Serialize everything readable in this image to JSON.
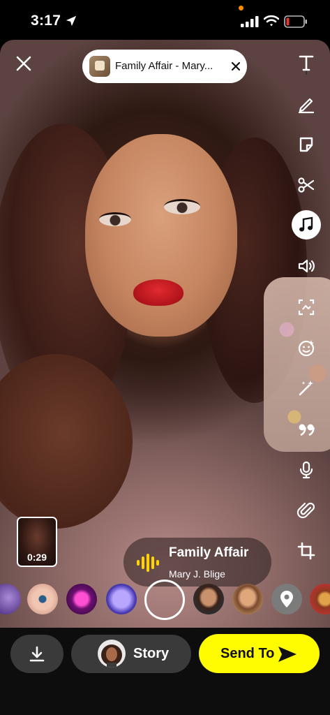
{
  "status_bar": {
    "time": "3:17",
    "location_icon": "location-arrow-icon",
    "signal_icon": "cellular-signal-icon",
    "wifi_icon": "wifi-icon",
    "battery_icon": "battery-low-icon",
    "battery_color": "#e53935",
    "indicator_color": "#ff8a00"
  },
  "sound_pill": {
    "title": "Family Affair - Mary...",
    "thumb_icon": "album-art-thumbnail",
    "close_icon": "close-icon"
  },
  "toolbar": {
    "tools": [
      {
        "name": "text-tool",
        "icon": "text-icon"
      },
      {
        "name": "draw-tool",
        "icon": "pencil-icon"
      },
      {
        "name": "sticker-tool",
        "icon": "sticker-icon"
      },
      {
        "name": "scissors-tool",
        "icon": "scissors-icon"
      },
      {
        "name": "music-tool",
        "icon": "music-note-icon",
        "active": true
      },
      {
        "name": "volume-tool",
        "icon": "speaker-icon"
      },
      {
        "name": "scan-tool",
        "icon": "scan-icon"
      },
      {
        "name": "lens-tool",
        "icon": "smiley-icon"
      },
      {
        "name": "magic-tool",
        "icon": "magic-wand-icon"
      },
      {
        "name": "quote-tool",
        "icon": "quote-icon"
      },
      {
        "name": "voice-tool",
        "icon": "microphone-icon"
      },
      {
        "name": "attach-tool",
        "icon": "paperclip-icon"
      },
      {
        "name": "crop-tool",
        "icon": "crop-icon"
      }
    ]
  },
  "clip": {
    "duration": "0:29"
  },
  "music_card": {
    "title": "Family Affair",
    "artist": "Mary J. Blige",
    "icon": "audio-waveform-icon",
    "accent": "#ffd400"
  },
  "lenses": [
    {
      "name": "lens-purple-face"
    },
    {
      "name": "lens-eye-makeup"
    },
    {
      "name": "lens-neon-heart"
    },
    {
      "name": "lens-cartoon-cube"
    },
    {
      "name": "lens-portrait-1"
    },
    {
      "name": "lens-portrait-2"
    },
    {
      "name": "lens-location-pin"
    },
    {
      "name": "lens-burger"
    }
  ],
  "bottom_bar": {
    "save_icon": "download-icon",
    "story_label": "Story",
    "send_label": "Send To",
    "send_color": "#fffc00",
    "send_icon": "send-arrow-icon"
  }
}
